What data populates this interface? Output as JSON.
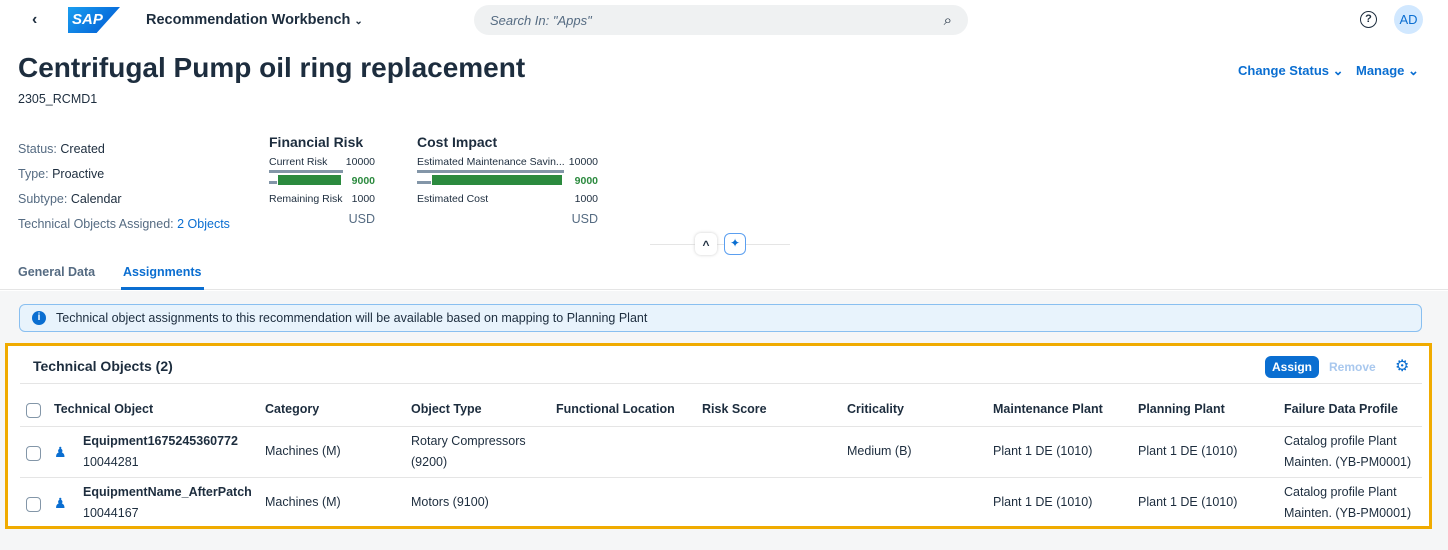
{
  "shell": {
    "app_title": "Recommendation Workbench",
    "search_placeholder": "Search In: \"Apps\"",
    "avatar": "AD",
    "logo": "SAP"
  },
  "header": {
    "title": "Centrifugal Pump oil ring replacement",
    "id": "2305_RCMD1",
    "change_status": "Change Status",
    "manage": "Manage"
  },
  "attributes": [
    {
      "label": "Status:",
      "value": "Created"
    },
    {
      "label": "Type:",
      "value": "Proactive"
    },
    {
      "label": "Subtype:",
      "value": "Calendar"
    },
    {
      "label": "Technical Objects Assigned:",
      "value": "2 Objects"
    }
  ],
  "financial_risk": {
    "title": "Financial Risk",
    "top_label": "Current Risk",
    "top_value": "10000",
    "delta": "9000",
    "bottom_label": "Remaining Risk",
    "bottom_value": "1000",
    "unit": "USD",
    "bottom_fraction": 0.1
  },
  "cost_impact": {
    "title": "Cost Impact",
    "top_label": "Estimated Maintenance Savin...",
    "top_value": "10000",
    "delta": "9000",
    "bottom_label": "Estimated Cost",
    "bottom_value": "1000",
    "unit": "USD",
    "bottom_fraction": 0.1
  },
  "tabs": [
    {
      "label": "General Data",
      "selected": false
    },
    {
      "label": "Assignments",
      "selected": true
    }
  ],
  "info_message": "Technical object assignments to this recommendation will be available based on mapping to Planning Plant",
  "table": {
    "title": "Technical Objects (2)",
    "assign": "Assign",
    "remove": "Remove",
    "columns": [
      "Technical Object",
      "Category",
      "Object Type",
      "Functional Location",
      "Risk Score",
      "Criticality",
      "Maintenance Plant",
      "Planning Plant",
      "Failure Data Profile"
    ],
    "rows": [
      {
        "name": "Equipment1675245360772",
        "id": "10044281",
        "category": "Machines (M)",
        "type1": "Rotary Compressors",
        "type2": "(9200)",
        "floc": "",
        "risk": "",
        "criticality": "Medium (B)",
        "mplant": "Plant 1 DE (1010)",
        "pplant": "Plant 1 DE (1010)",
        "profile1": "Catalog profile Plant",
        "profile2": "Mainten. (YB-PM0001)"
      },
      {
        "name": "EquipmentName_AfterPatch",
        "id": "10044167",
        "category": "Machines (M)",
        "type1": "Motors (9100)",
        "type2": "",
        "floc": "",
        "risk": "",
        "criticality": "",
        "mplant": "Plant 1 DE (1010)",
        "pplant": "Plant 1 DE (1010)",
        "profile1": "Catalog profile Plant",
        "profile2": "Mainten. (YB-PM0001)"
      }
    ]
  },
  "colors": {
    "accent": "#0a6ed1",
    "positive": "#2b8a3e",
    "highlight": "#f0ab00"
  }
}
